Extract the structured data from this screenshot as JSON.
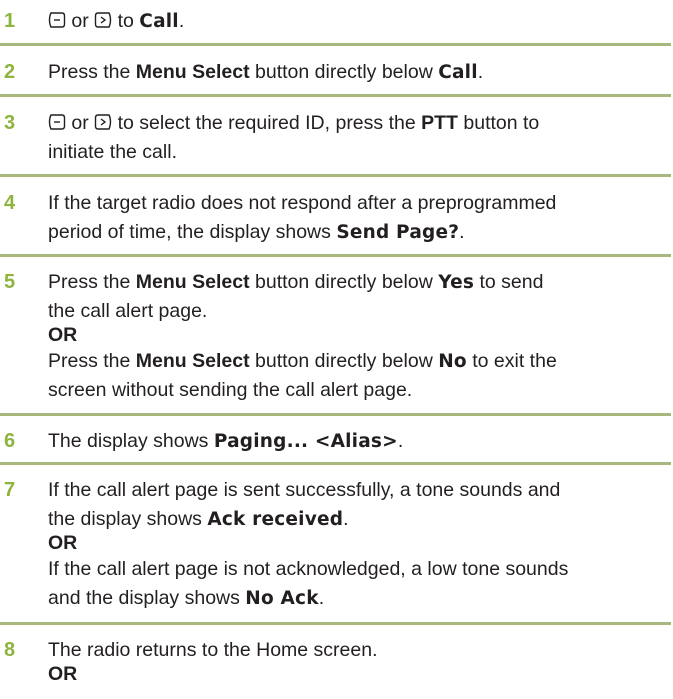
{
  "nav_left_icon": "nav-left-button-icon",
  "nav_right_icon": "nav-right-button-icon",
  "accent_color": "#8db43c",
  "rule_color": "#a8b87c",
  "steps": [
    {
      "number": "1",
      "or_word": "or",
      "text_to": "to",
      "display_call": "Call",
      "period": "."
    },
    {
      "number": "2",
      "text_a": "Press the",
      "menu_select": "Menu Select",
      "text_b": "button directly below",
      "display_call": "Call",
      "period": "."
    },
    {
      "number": "3",
      "or_word": "or",
      "text_a": "to select the required ID, press the",
      "ptt": "PTT",
      "text_b": "button to",
      "text_c": "initiate the call."
    },
    {
      "number": "4",
      "text_a": "If the target radio does not respond after a preprogrammed",
      "text_b": "period of time, the display shows",
      "display_send_page": "Send Page?",
      "period": "."
    },
    {
      "number": "5",
      "text_a": "Press the",
      "menu_select": "Menu Select",
      "text_b": "button directly below",
      "display_yes": "Yes",
      "text_c": "to send",
      "text_d": "the call alert page.",
      "or_label": "OR",
      "text_e": "Press the",
      "menu_select_2": "Menu Select",
      "text_f": "button directly below",
      "display_no": "No",
      "text_g": "to exit the",
      "text_h": "screen without sending the call alert page."
    },
    {
      "number": "6",
      "text_a": "The display shows",
      "display_paging": "Paging... <Alias>",
      "period": "."
    },
    {
      "number": "7",
      "text_a": "If the call alert page is sent successfully, a tone sounds and",
      "text_b": "the display shows",
      "display_ack": "Ack received",
      "period": ".",
      "or_label": "OR",
      "text_c": "If the call alert page is not acknowledged, a low tone sounds",
      "text_d": "and the display shows",
      "display_no_ack": "No Ack",
      "period_2": "."
    },
    {
      "number": "8",
      "text_a": "The radio returns to the Home screen.",
      "or_label": "OR"
    }
  ]
}
